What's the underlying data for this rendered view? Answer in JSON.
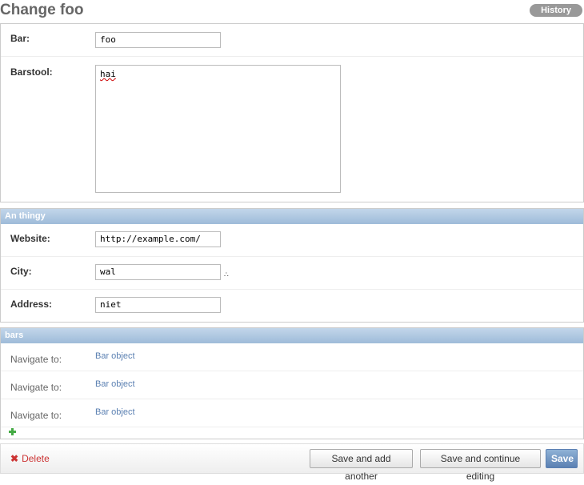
{
  "header": {
    "title": "Change foo",
    "history_label": "History"
  },
  "main_fields": {
    "bar_label": "Bar:",
    "bar_value": "foo",
    "barstool_label": "Barstool:",
    "barstool_value": "hai"
  },
  "thingy": {
    "title": "An thingy",
    "website_label": "Website:",
    "website_value": "http://example.com/",
    "city_label": "City:",
    "city_value": "wal",
    "address_label": "Address:",
    "address_value": "niet"
  },
  "bars": {
    "title": "bars",
    "rows": [
      {
        "label": "Navigate to:",
        "link": "Bar object"
      },
      {
        "label": "Navigate to:",
        "link": "Bar object"
      },
      {
        "label": "Navigate to:",
        "link": "Bar object"
      }
    ]
  },
  "submit": {
    "delete_label": "Delete",
    "save_add_label": "Save and add another",
    "save_continue_label": "Save and continue editing",
    "save_label": "Save"
  },
  "colors": {
    "header_accent": "#9ebbd9",
    "link": "#5b80b2",
    "delete": "#cc3434",
    "add_icon": "#44aa44"
  }
}
